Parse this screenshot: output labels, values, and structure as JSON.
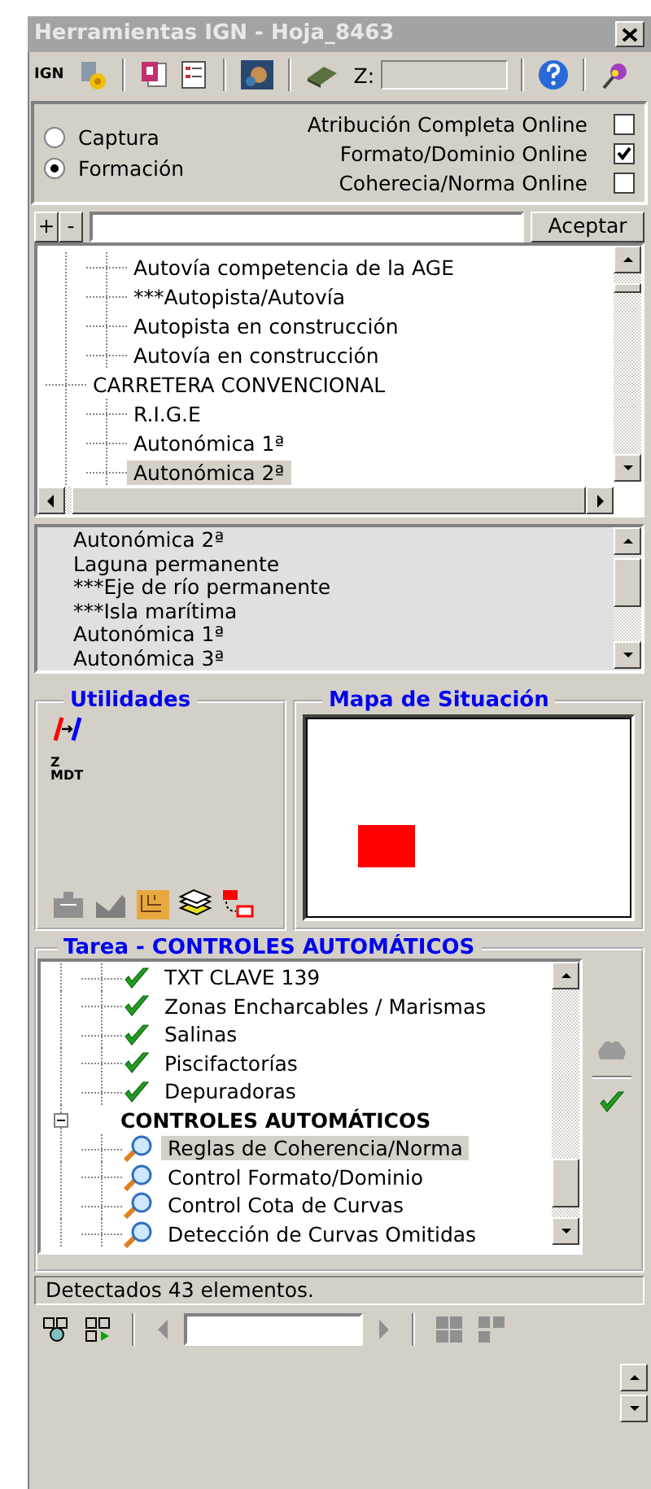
{
  "window": {
    "title": "Herramientas IGN - Hoja_8463"
  },
  "toolbar": {
    "logo": "IGN",
    "z_label": "Z:"
  },
  "modes": [
    {
      "label": "Captura",
      "selected": false
    },
    {
      "label": "Formación",
      "selected": true
    }
  ],
  "online_checks": [
    {
      "label": "Atribución Completa Online",
      "checked": false
    },
    {
      "label": "Formato/Dominio Online",
      "checked": true
    },
    {
      "label": "Coherecia/Norma Online",
      "checked": false
    }
  ],
  "filter": {
    "buttons": [
      "+",
      "-"
    ],
    "accept": "Aceptar"
  },
  "layer_tree": {
    "nodes": [
      {
        "children": [
          {
            "label": "Autovía competencia de la AGE",
            "selected": false
          },
          {
            "label": "***Autopista/Autovía",
            "selected": false
          },
          {
            "label": "Autopista  en construcción",
            "selected": false
          },
          {
            "label": "Autovía en construcción",
            "selected": false
          }
        ]
      },
      {
        "label": "CARRETERA CONVENCIONAL",
        "selected": false,
        "children": [
          {
            "label": "R.I.G.E",
            "selected": false
          },
          {
            "label": "Autonómica 1ª",
            "selected": false
          },
          {
            "label": "Autonómica 2ª",
            "selected": true
          }
        ]
      }
    ]
  },
  "layer_list": {
    "items": [
      "Autonómica 2ª",
      "Laguna permanente",
      "***Eje de río permanente",
      "***Isla marítima",
      "Autonómica 1ª",
      "Autonómica 3ª"
    ]
  },
  "utilities": {
    "title": "Utilidades",
    "mdt_top": "Z",
    "mdt_bottom": "MDT"
  },
  "map": {
    "title": "Mapa de Situación"
  },
  "task": {
    "title": "Tarea - CONTROLES AUTOMÁTICOS",
    "nodes": [
      {
        "children": [
          {
            "label": "TXT CLAVE 139",
            "kind": "done",
            "selected": false
          },
          {
            "label": "Zonas Encharcables / Marismas",
            "kind": "done",
            "selected": false
          },
          {
            "label": "Salinas",
            "kind": "done",
            "selected": false
          },
          {
            "label": "Piscifactorías",
            "kind": "done",
            "selected": false
          },
          {
            "label": "Depuradoras",
            "kind": "done",
            "selected": false
          }
        ]
      },
      {
        "label": "CONTROLES AUTOMÁTICOS",
        "expanded": true,
        "selected": false,
        "children": [
          {
            "label": "Reglas de Coherencia/Norma",
            "kind": "control",
            "selected": true
          },
          {
            "label": "Control Formato/Dominio",
            "kind": "control",
            "selected": false
          },
          {
            "label": "Control Cota de Curvas",
            "kind": "control",
            "selected": false
          },
          {
            "label": "Detección de Curvas Omitidas",
            "kind": "control",
            "selected": false
          }
        ]
      }
    ]
  },
  "status": "Detectados 43 elementos."
}
